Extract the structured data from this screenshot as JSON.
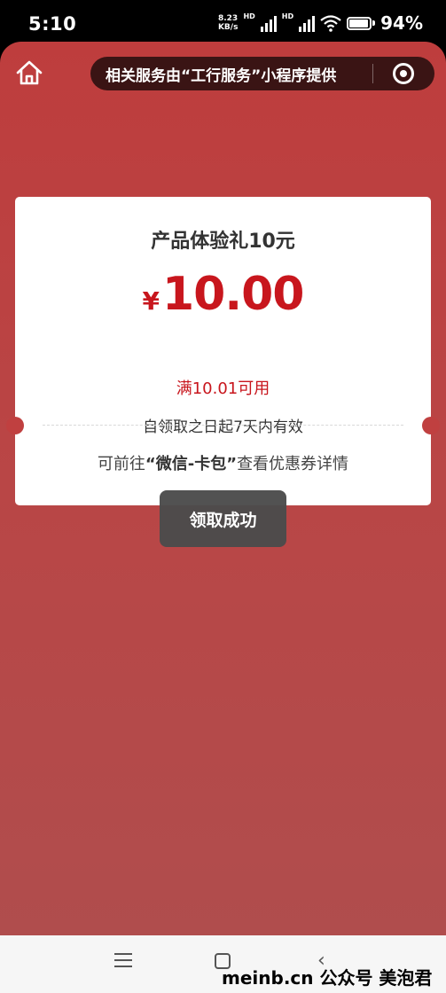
{
  "status_bar": {
    "time": "5:10",
    "speed_value": "8.23",
    "speed_unit": "KB/s",
    "network_label": "HD",
    "battery": "94%",
    "battery_level": 0.94
  },
  "header": {
    "capsule_text": "相关服务由“工行服务”小程序提供"
  },
  "coupon": {
    "title": "产品体验礼10元",
    "currency": "¥",
    "amount": "10.00",
    "condition": "满10.01可用",
    "validity": "自领取之日起7天内有效",
    "hint_prefix": "可前往",
    "hint_bold": "“微信-卡包”",
    "hint_suffix": "查看优惠券详情"
  },
  "toast": {
    "message": "领取成功"
  },
  "watermark": {
    "text": "meinb.cn 公众号 美泡君"
  },
  "colors": {
    "background": "#be3d3d",
    "accent": "#c8161d",
    "capsule": "#3a1414",
    "toast": "#4b4b4b"
  },
  "icons": {
    "home": "home-icon",
    "target": "target-icon",
    "menu": "menu-icon",
    "nav_home": "square-icon",
    "back": "back-icon"
  }
}
